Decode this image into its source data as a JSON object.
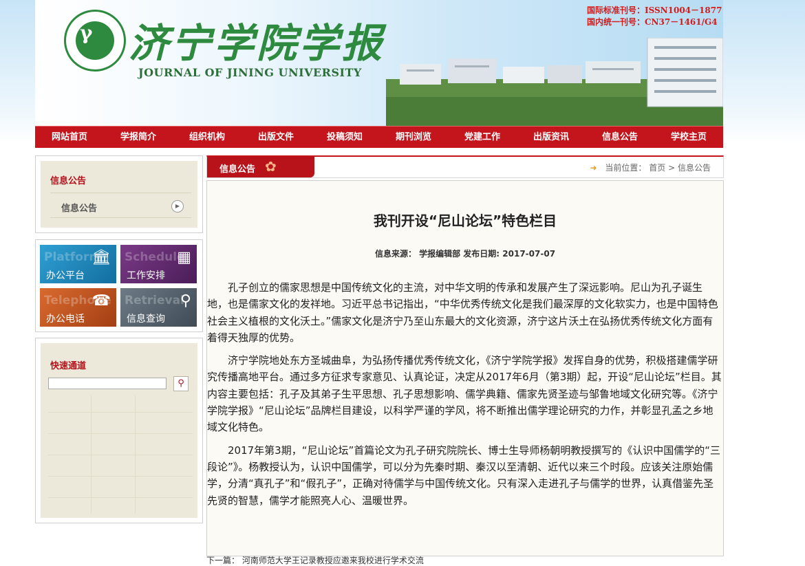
{
  "header": {
    "title_cn": "济宁学院学报",
    "title_en": "JOURNAL OF JINING UNIVERSITY",
    "issn": "国际标准刊号：ISSN1004－1877",
    "cn": "国内统一刊号：CN37－1461/G4",
    "logo_ring_text": "JINING UNIVERSITY"
  },
  "nav": [
    "网站首页",
    "学报简介",
    "组织机构",
    "出版文件",
    "投稿须知",
    "期刊浏览",
    "党建工作",
    "出版资讯",
    "信息公告",
    "学校主页"
  ],
  "sidebar": {
    "box1_title": "信息公告",
    "box1_item": "信息公告",
    "tiles": [
      {
        "ghost": "Platform",
        "label": "办公平台",
        "icon": "bank-icon"
      },
      {
        "ghost": "Schedule",
        "label": "工作安排",
        "icon": "bar-chart-icon"
      },
      {
        "ghost": "Telephone",
        "label": "办公电话",
        "icon": "phone-icon"
      },
      {
        "ghost": "Retrieval",
        "label": "信息查询",
        "icon": "search-icon"
      }
    ],
    "quick_title": "快速通道"
  },
  "breadcrumb": {
    "tab": "信息公告",
    "location_label": "当前位置：",
    "home": "首页",
    "sep": ">",
    "current": "信息公告"
  },
  "article": {
    "title": "我刊开设“尼山论坛”特色栏目",
    "meta": "信息来源： 学报编辑部 发布日期: 2017-07-07",
    "paragraphs": [
      "孔子创立的儒家思想是中国传统文化的主流，对中华文明的传承和发展产生了深远影响。尼山为孔子诞生地，也是儒家文化的发祥地。习近平总书记指出，“中华优秀传统文化是我们最深厚的文化软实力，也是中国特色社会主义植根的文化沃土。”儒家文化是济宁乃至山东最大的文化资源，济宁这片沃土在弘扬优秀传统文化方面有着得天独厚的优势。",
      "济宁学院地处东方圣城曲阜，为弘扬传播优秀传统文化，《济宁学院学报》发挥自身的优势，积极搭建儒学研究传播高地平台。通过多方征求专家意见、认真论证，决定从2017年6月（第3期）起，开设“尼山论坛”栏目。其内容主要包括：孔子及其弟子生平思想、孔子思想影响、儒学典籍、儒家先贤圣迹与邹鲁地域文化研究等。《济宁学院学报》“尼山论坛”品牌栏目建设，以科学严谨的学风，将不断推出儒学理论研究的力作，并彰显孔孟之乡地域文化特色。",
      "2017年第3期，“尼山论坛”首篇论文为孔子研究院院长、博士生导师杨朝明教授撰写的《认识中国儒学的“三段论”》。杨教授认为，认识中国儒学，可以分为先秦时期、秦汉以至清朝、近代以来三个时段。应该关注原始儒学，分清“真孔子”和“假孔子”，正确对待儒学与中国传统文化。只有深入走进孔子与儒学的世界，认真借鉴先圣先贤的智慧，儒学才能照亮人心、温暖世界。"
    ],
    "next_label": "下一篇：",
    "next_title": "河南师范大学王记录教授应邀来我校进行学术交流"
  }
}
